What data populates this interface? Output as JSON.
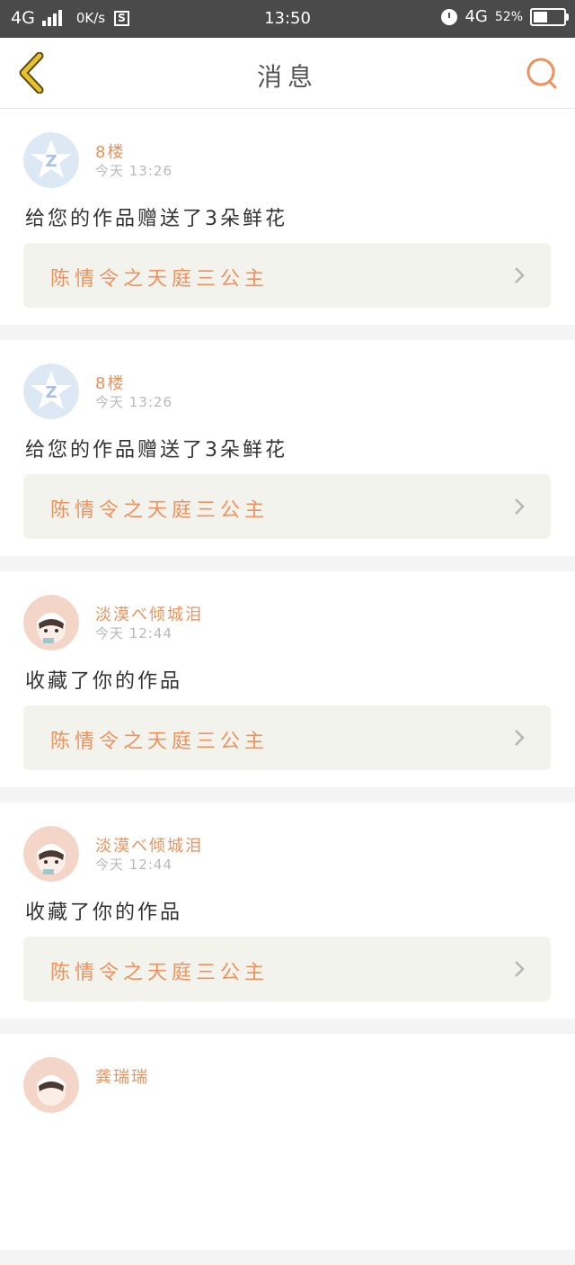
{
  "status_bar": {
    "network": "4G",
    "speed": "0K/s",
    "sim_badge": "S",
    "time": "13:50",
    "network_right": "4G",
    "battery_percent": "52%",
    "battery_level": 0.52
  },
  "header": {
    "title": "消息",
    "back_icon": "chevron-left-icon",
    "search_icon": "search-icon"
  },
  "colors": {
    "accent": "#f0915c",
    "back_icon": "#e0b52c",
    "card_link_bg": "#f3f3ee"
  },
  "messages": [
    {
      "avatar": "qq-star-avatar",
      "user": "8楼",
      "time": "今天 13:26",
      "text": "给您的作品赠送了3朵鲜花",
      "work_title": "陈情令之天庭三公主"
    },
    {
      "avatar": "qq-star-avatar",
      "user": "8楼",
      "time": "今天 13:26",
      "text": "给您的作品赠送了3朵鲜花",
      "work_title": "陈情令之天庭三公主"
    },
    {
      "avatar": "anime-girl-avatar",
      "user": "淡漠べ倾城泪",
      "time": "今天 12:44",
      "text": "收藏了你的作品",
      "work_title": "陈情令之天庭三公主"
    },
    {
      "avatar": "anime-girl-avatar",
      "user": "淡漠べ倾城泪",
      "time": "今天 12:44",
      "text": "收藏了你的作品",
      "work_title": "陈情令之天庭三公主"
    },
    {
      "avatar": "anime-girl-avatar",
      "user": "龚瑞瑞",
      "time": "",
      "text": "",
      "work_title": ""
    }
  ]
}
